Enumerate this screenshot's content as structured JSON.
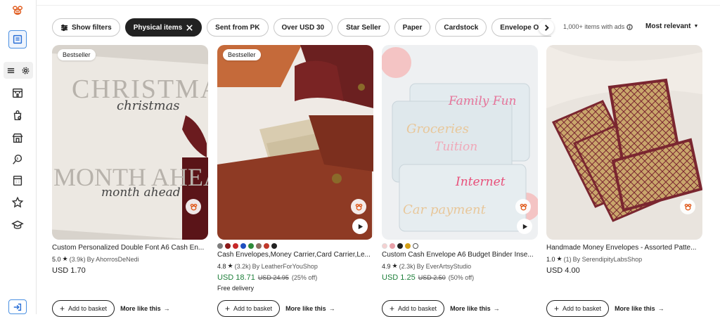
{
  "filters": {
    "show_filters": "Show filters",
    "chips": [
      "Physical items",
      "Sent from PK",
      "Over USD 30",
      "Star Seller",
      "Paper",
      "Cardstock",
      "Envelope Organizer"
    ],
    "results": "1,000+ items with ads",
    "sort": "Most relevant"
  },
  "listings": [
    {
      "badge": "Bestseller",
      "title": "Custom Personalized Double Font A6 Cash En...",
      "rating": "5.0",
      "reviews": "(3.9k)",
      "shop": "By AhorrosDeNedi",
      "price": "USD 1.70",
      "image_text": {
        "line1": "CHRISTMAS",
        "script1": "christmas",
        "line2": "MONTH AHEAD",
        "script2": "month ahead"
      }
    },
    {
      "badge": "Bestseller",
      "title": "Cash Envelopes,Money Carrier,Card Carrier,Le...",
      "rating": "4.8",
      "reviews": "(3.2k)",
      "shop": "By LeatherForYouShop",
      "price": "USD 18.71",
      "old_price": "USD 24.95",
      "discount": "(25% off)",
      "delivery": "Free delivery",
      "swatches": [
        "#7d7d7d",
        "#8b1a1a",
        "#c62828",
        "#1e4fbf",
        "#2e8b3a",
        "#8d6e63",
        "#c0392b",
        "#222222"
      ]
    },
    {
      "title": "Custom Cash Envelope A6 Budget Binder Inse...",
      "rating": "4.9",
      "reviews": "(2.3k)",
      "shop": "By EverArtsyStudio",
      "price": "USD 1.25",
      "old_price": "USD 2.50",
      "discount": "(50% off)",
      "swatches": [
        "#f5d0d0",
        "#e8a0a8",
        "#222222",
        "#d4a017",
        "#ffffff"
      ],
      "image_text": {
        "t1": "Family Fun",
        "t2": "Groceries",
        "t3": "Tuition",
        "t4": "Internet",
        "t5": "Car payment"
      }
    },
    {
      "title": "Handmade Money Envelopes - Assorted Patte...",
      "rating": "1.0",
      "reviews": "(1)",
      "shop": "By SerendipityLabsShop",
      "price": "USD 4.00"
    }
  ],
  "actions": {
    "basket": "Add to basket",
    "more": "More like this"
  },
  "colors": {
    "sale": "#1e7f3a",
    "accent": "#e05a1c",
    "active": "#4a90e2"
  }
}
